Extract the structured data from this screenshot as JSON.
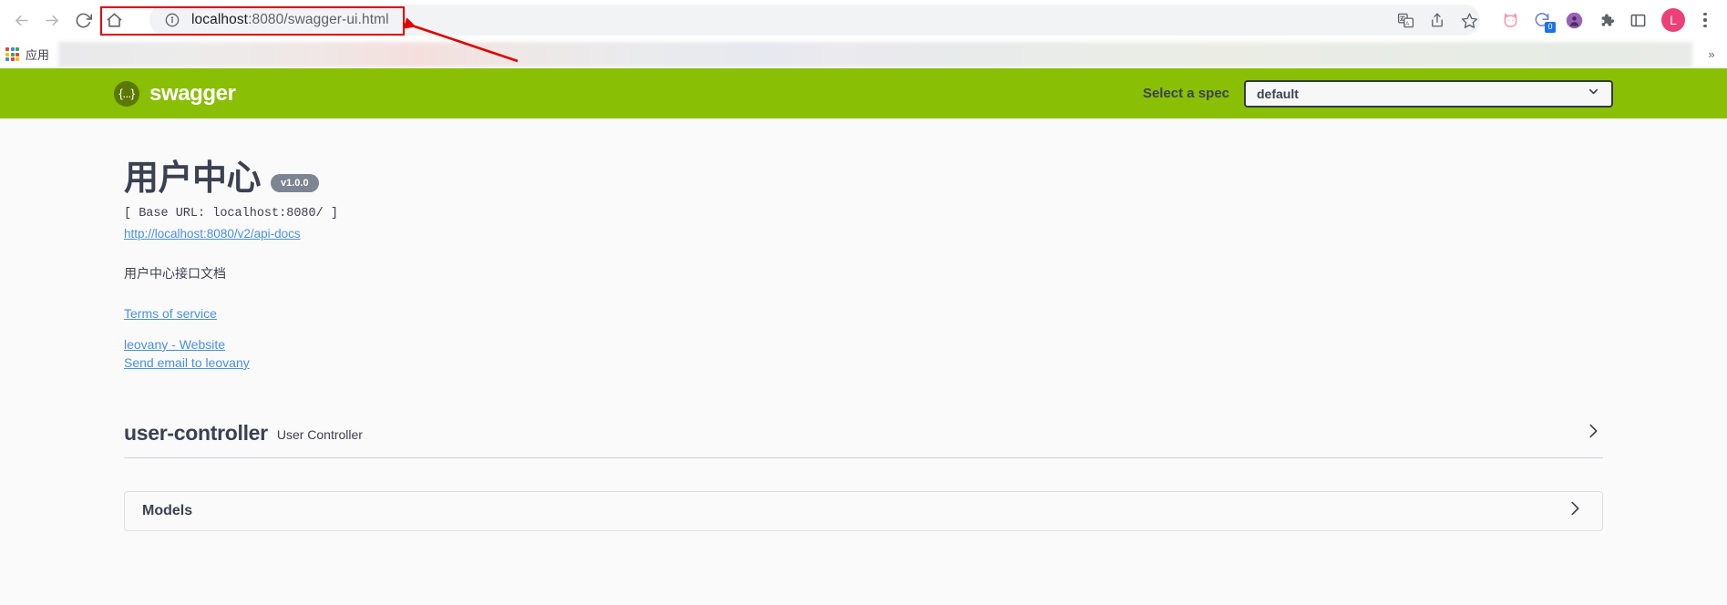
{
  "browser": {
    "nav": {
      "back_icon": "arrow-left-icon",
      "forward_icon": "arrow-right-icon",
      "reload_icon": "reload-icon",
      "home_icon": "home-icon"
    },
    "omnibox": {
      "site_info_icon": "info-circle-icon",
      "url_host": "localhost",
      "url_path": ":8080/swagger-ui.html",
      "url_full": "localhost:8080/swagger-ui.html"
    },
    "toolbar_icons": [
      {
        "name": "translate-icon"
      },
      {
        "name": "share-icon"
      },
      {
        "name": "bookmark-star-icon"
      },
      {
        "name": "cat-extension-icon"
      },
      {
        "name": "sync-extension-icon",
        "badge": "0"
      },
      {
        "name": "avatar-extension-icon"
      },
      {
        "name": "extensions-puzzle-icon"
      },
      {
        "name": "sidepanel-icon"
      }
    ],
    "profile": {
      "initial": "L"
    },
    "menu_icon": "three-dots-vertical-icon",
    "bookmarks": {
      "apps_icon": "apps-grid-icon",
      "apps_label": "应用",
      "overflow_label": "»"
    }
  },
  "annotation": {
    "rect_color": "#e00000",
    "arrow_color": "#e00000"
  },
  "swagger": {
    "topbar": {
      "logo_mark": "{...}",
      "wordmark": "swagger",
      "spec_label": "Select a spec",
      "spec_value": "default",
      "spec_chevron_icon": "chevron-down-icon"
    },
    "info": {
      "title": "用户中心",
      "version_badge": "v1.0.0",
      "base_url": "[ Base URL: localhost:8080/ ]",
      "api_docs_link": "http://localhost:8080/v2/api-docs",
      "description": "用户中心接口文档",
      "terms_link": "Terms of service",
      "website_link": "leovany - Website",
      "email_link": "Send email to leovany"
    },
    "tag": {
      "name": "user-controller",
      "description": "User Controller",
      "expand_icon": "chevron-right-icon"
    },
    "models": {
      "title": "Models",
      "expand_icon": "chevron-right-icon"
    },
    "colors": {
      "brand_green": "#89bf04",
      "text_dark": "#3b4151",
      "link_blue": "#4a90e2",
      "badge_gray": "#7d8492",
      "page_bg": "#fafafa"
    }
  }
}
